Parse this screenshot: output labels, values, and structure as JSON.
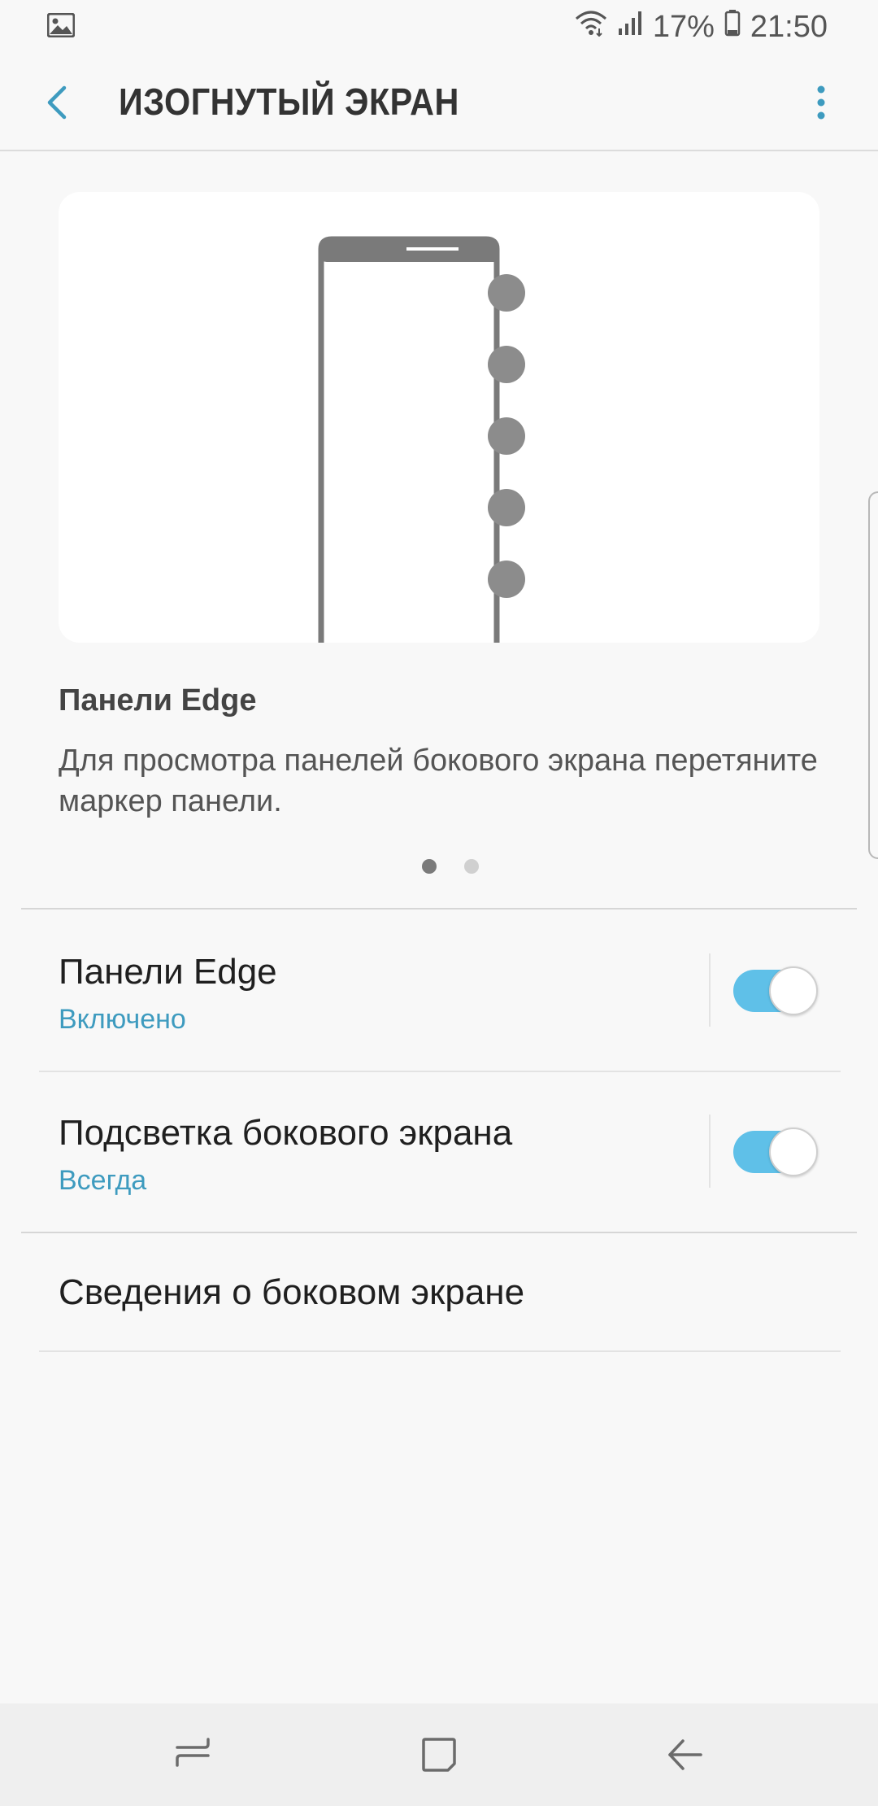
{
  "status_bar": {
    "battery": "17%",
    "time": "21:50",
    "icons": [
      "gallery-icon",
      "wifi-icon",
      "signal-icon",
      "battery-icon"
    ]
  },
  "header": {
    "title": "ИЗОГНУТЫЙ ЭКРАН",
    "back_icon": "back-arrow-icon",
    "menu_icon": "more-vert-icon"
  },
  "feature_card": {
    "title": "Панели Edge",
    "description": "Для просмотра панелей бокового экрана перетяните маркер панели.",
    "pages": 2,
    "current_page": 1
  },
  "settings": [
    {
      "title": "Панели Edge",
      "subtitle": "Включено",
      "toggle": true
    },
    {
      "title": "Подсветка бокового экрана",
      "subtitle": "Всегда",
      "toggle": true
    },
    {
      "title": "Сведения о боковом экране"
    }
  ],
  "colors": {
    "accent": "#3e9bbf",
    "switch_on": "#5fc0e8",
    "background": "#f8f8f8"
  },
  "nav_bar": {
    "icons": [
      "recents-icon",
      "home-icon",
      "back-icon"
    ]
  }
}
